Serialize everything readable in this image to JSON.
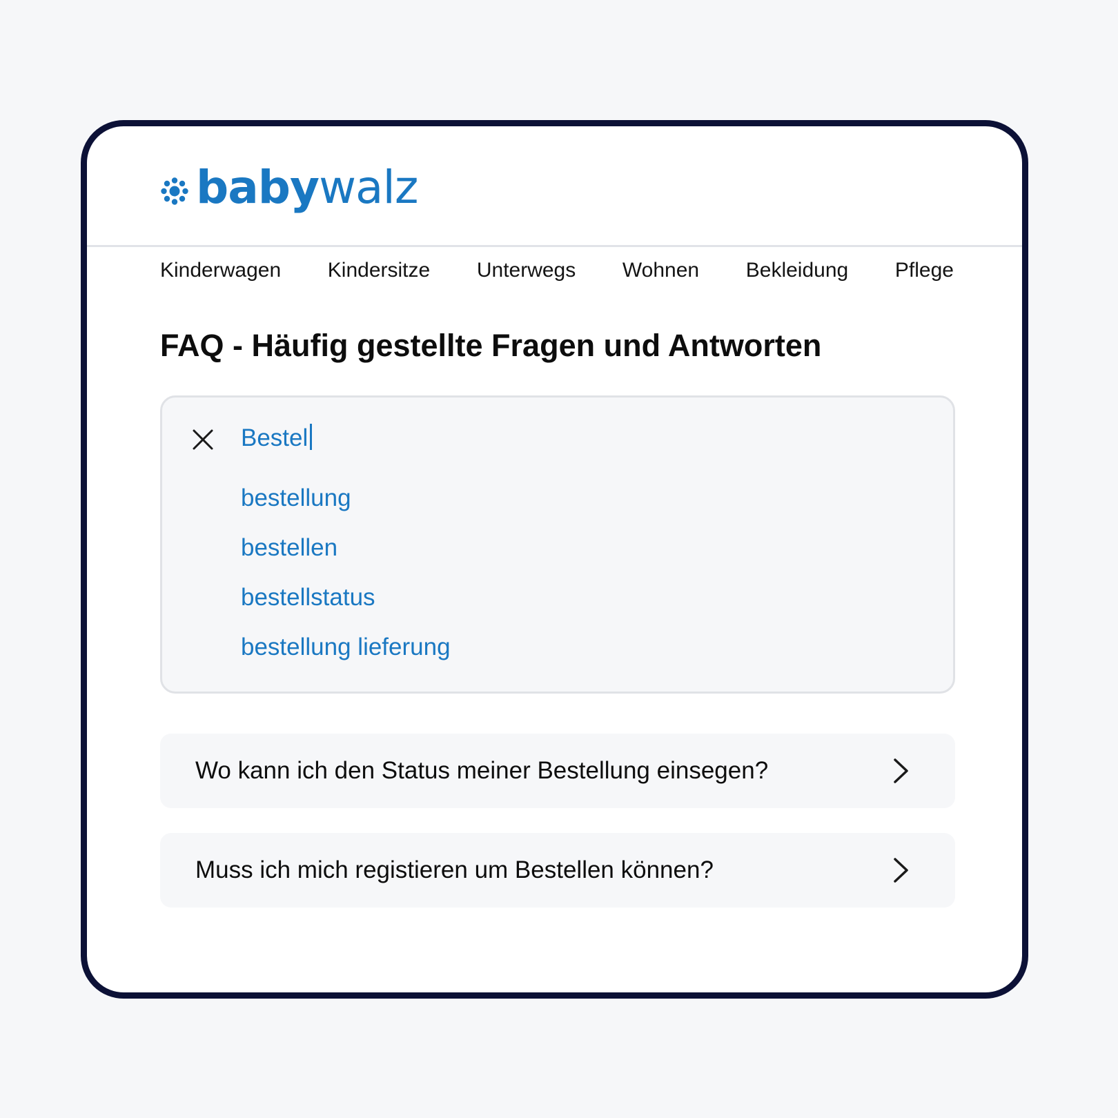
{
  "brand": {
    "logo_bold": "baby",
    "logo_light": "walz",
    "color": "#1a78c2"
  },
  "nav": {
    "items": [
      "Kinderwagen",
      "Kindersitze",
      "Unterwegs",
      "Wohnen",
      "Bekleidung",
      "Pflege"
    ]
  },
  "page": {
    "title": "FAQ - Häufig gestellte Fragen und Antworten"
  },
  "search": {
    "clear_icon": "close-icon",
    "query": "Bestel",
    "suggestions": [
      "bestellung",
      "bestellen",
      "bestellstatus",
      "bestellung lieferung"
    ]
  },
  "faq": {
    "chevron_icon": "chevron-right-icon",
    "items": [
      "Wo kann ich den Status meiner Bestellung einsegen?",
      "Muss ich mich registieren um Bestellen können?"
    ]
  }
}
